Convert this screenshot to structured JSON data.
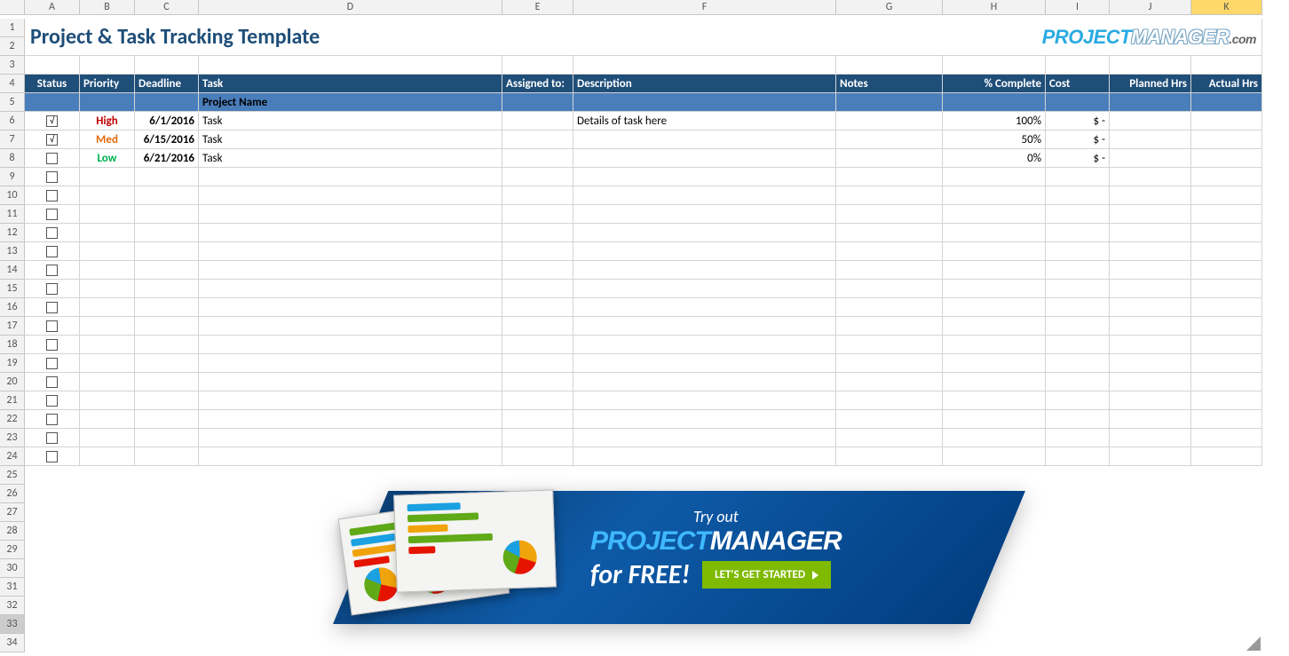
{
  "columns": [
    "A",
    "B",
    "C",
    "D",
    "E",
    "F",
    "G",
    "H",
    "I",
    "J",
    "K"
  ],
  "selectedColumn": "K",
  "rowCount": 34,
  "title": "Project & Task Tracking Template",
  "logo": {
    "p": "PROJECT",
    "m": "MANAGER",
    "suffix": ".com"
  },
  "headers": {
    "status": "Status",
    "priority": "Priority",
    "deadline": "Deadline",
    "task": "Task",
    "assigned": "Assigned to:",
    "description": "Description",
    "notes": "Notes",
    "pct": "% Complete",
    "cost": "Cost",
    "planned": "Planned Hrs",
    "actual": "Actual Hrs"
  },
  "projectRowLabel": "Project Name",
  "rows": [
    {
      "statusCheck": true,
      "priority": "High",
      "priorityClass": "priority-high",
      "deadline": "6/1/2016",
      "task": "Task",
      "assigned": "",
      "description": "Details of task here",
      "notes": "",
      "pct": "100%",
      "cost": "$           -",
      "planned": "",
      "actual": ""
    },
    {
      "statusCheck": true,
      "priority": "Med",
      "priorityClass": "priority-med",
      "deadline": "6/15/2016",
      "task": "Task",
      "assigned": "",
      "description": "",
      "notes": "",
      "pct": "50%",
      "cost": "$           -",
      "planned": "",
      "actual": ""
    },
    {
      "statusCheck": false,
      "priority": "Low",
      "priorityClass": "priority-low",
      "deadline": "6/21/2016",
      "task": "Task",
      "assigned": "",
      "description": "",
      "notes": "",
      "pct": "0%",
      "cost": "$           -",
      "planned": "",
      "actual": ""
    }
  ],
  "emptyRowsFrom": 9,
  "emptyRowsTo": 24,
  "blankRowsFrom": 25,
  "blankRowsTo": 34,
  "checkMark": "√",
  "banner": {
    "tryText": "Try out",
    "brandP": "PROJECT",
    "brandM": "MANAGER",
    "forFree": "for FREE!",
    "cta": "LET'S GET STARTED"
  }
}
